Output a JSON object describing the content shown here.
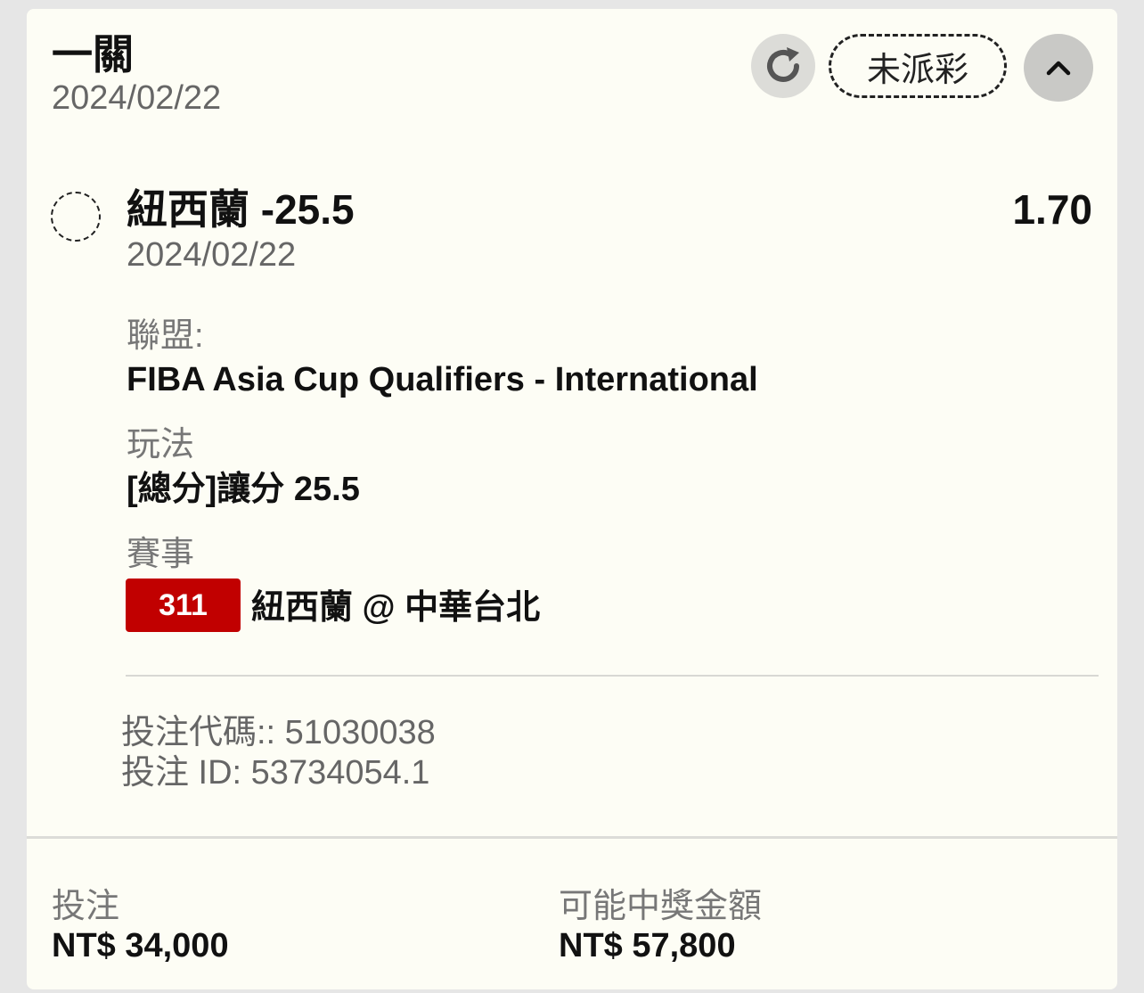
{
  "header": {
    "bet_type": "一關",
    "date": "2024/02/22",
    "status": "未派彩",
    "refresh_icon": "refresh-icon",
    "collapse_icon": "chevron-up-icon"
  },
  "selection": {
    "name": "紐西蘭 -25.5",
    "odds": "1.70",
    "date": "2024/02/22",
    "league_label": "聯盟:",
    "league_value": "FIBA Asia Cup Qualifiers - International",
    "market_label": "玩法",
    "market_value": "[總分]讓分 25.5",
    "event_label": "賽事",
    "event_id": "311",
    "event_name": "紐西蘭 @ 中華台北"
  },
  "codes": {
    "bet_code": "投注代碼:: 51030038",
    "bet_id": "投注 ID: 53734054.1"
  },
  "footer": {
    "stake_label": "投注",
    "stake_value": "NT$ 34,000",
    "payout_label": "可能中獎金額",
    "payout_value": "NT$ 57,800"
  },
  "colors": {
    "badge_red": "#c10000",
    "card_bg": "#fdfdf5"
  }
}
